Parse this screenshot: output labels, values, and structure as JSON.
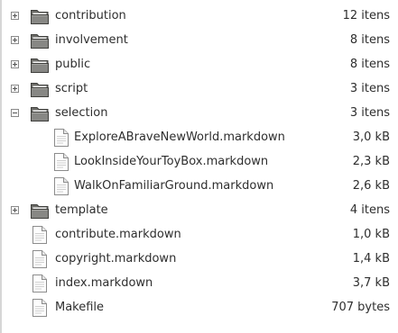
{
  "files": [
    {
      "name": "contribution",
      "size": "12 itens",
      "kind": "folder",
      "state": "collapsed",
      "indent": 0
    },
    {
      "name": "involvement",
      "size": "8 itens",
      "kind": "folder",
      "state": "collapsed",
      "indent": 0
    },
    {
      "name": "public",
      "size": "8 itens",
      "kind": "folder",
      "state": "collapsed",
      "indent": 0
    },
    {
      "name": "script",
      "size": "3 itens",
      "kind": "folder",
      "state": "collapsed",
      "indent": 0
    },
    {
      "name": "selection",
      "size": "3 itens",
      "kind": "folder",
      "state": "expanded",
      "indent": 0
    },
    {
      "name": "ExploreABraveNewWorld.markdown",
      "size": "3,0 kB",
      "kind": "file",
      "state": "none",
      "indent": 1
    },
    {
      "name": "LookInsideYourToyBox.markdown",
      "size": "2,3 kB",
      "kind": "file",
      "state": "none",
      "indent": 1
    },
    {
      "name": "WalkOnFamiliarGround.markdown",
      "size": "2,6 kB",
      "kind": "file",
      "state": "none",
      "indent": 1
    },
    {
      "name": "template",
      "size": "4 itens",
      "kind": "folder",
      "state": "collapsed",
      "indent": 0
    },
    {
      "name": "contribute.markdown",
      "size": "1,0 kB",
      "kind": "file",
      "state": "none",
      "indent": 0
    },
    {
      "name": "copyright.markdown",
      "size": "1,4 kB",
      "kind": "file",
      "state": "none",
      "indent": 0
    },
    {
      "name": "index.markdown",
      "size": "3,7 kB",
      "kind": "file",
      "state": "none",
      "indent": 0
    },
    {
      "name": "Makefile",
      "size": "707 bytes",
      "kind": "file",
      "state": "none",
      "indent": 0
    }
  ]
}
